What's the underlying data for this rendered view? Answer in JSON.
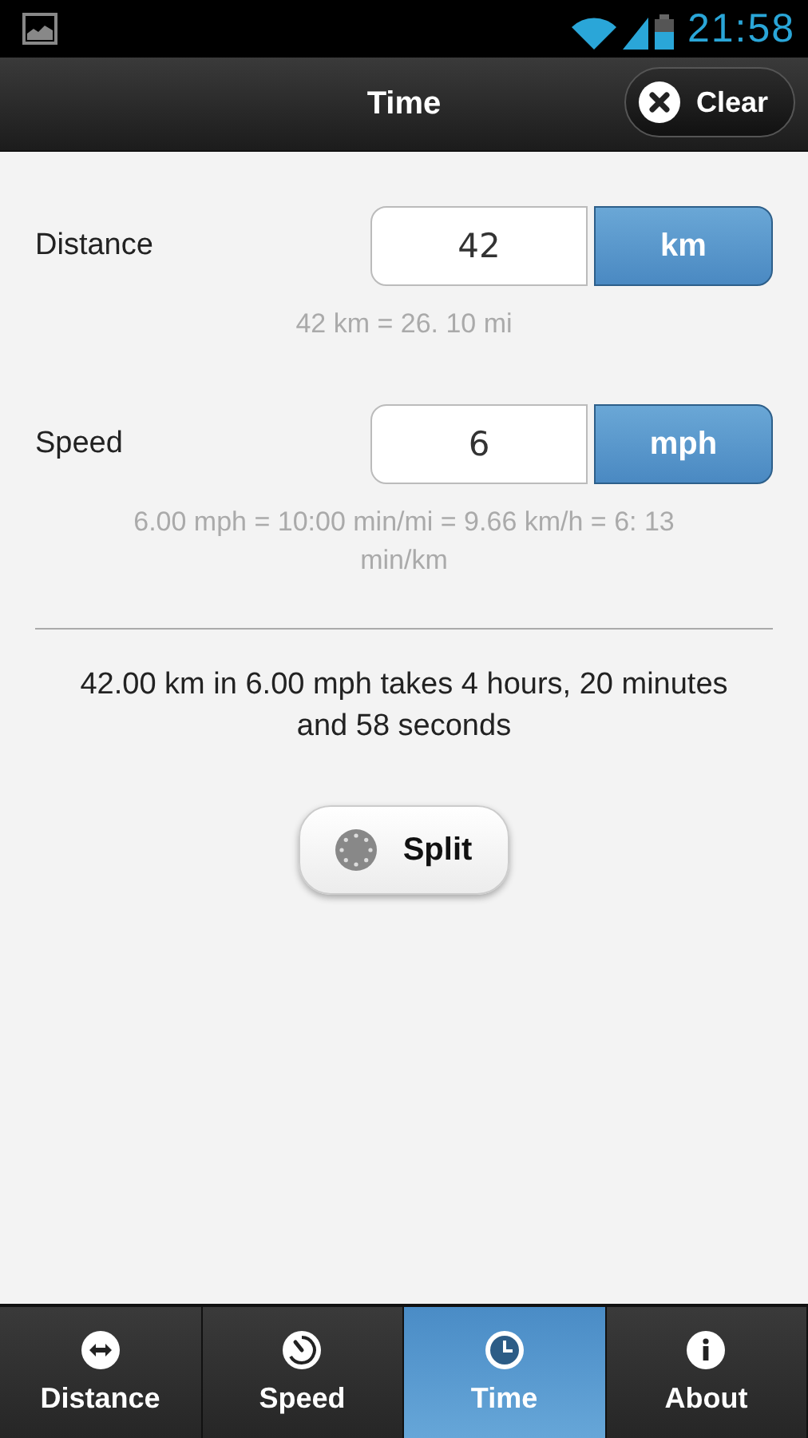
{
  "status_bar": {
    "time": "21:58"
  },
  "header": {
    "title": "Time",
    "clear_button": "Clear"
  },
  "inputs": [
    {
      "label": "Distance",
      "value": "42",
      "unit": "km",
      "conversion": "42 km = 26. 10 mi"
    },
    {
      "label": "Speed",
      "value": "6",
      "unit": "mph",
      "conversion": "6.00 mph =  10:00 min/mi = 9.66 km/h = 6: 13 min/km"
    }
  ],
  "result": "42.00 km in 6.00 mph takes 4 hours, 20 minutes and 58 seconds",
  "split_button": "Split",
  "tabs": [
    {
      "label": "Distance",
      "selected": false
    },
    {
      "label": "Speed",
      "selected": false
    },
    {
      "label": "Time",
      "selected": true
    },
    {
      "label": "About",
      "selected": false
    }
  ]
}
